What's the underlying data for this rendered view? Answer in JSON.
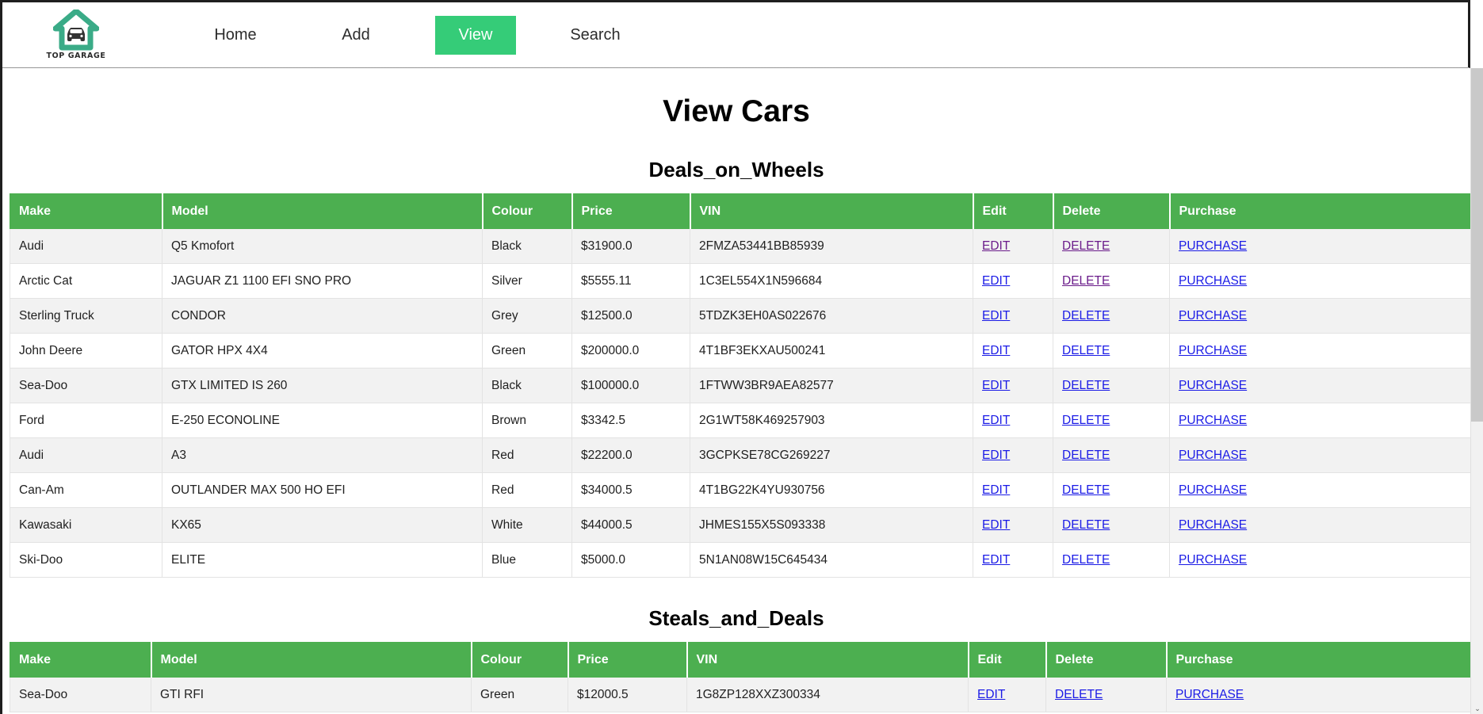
{
  "nav": {
    "logo": {
      "name": "top-garage-logo",
      "wordmark": "TOP GARAGE",
      "color": "#3aab87"
    },
    "items": [
      {
        "label": "Home",
        "active": false
      },
      {
        "label": "Add",
        "active": false
      },
      {
        "label": "View",
        "active": true
      },
      {
        "label": "Search",
        "active": false
      }
    ],
    "active_color": "#35cc78"
  },
  "page": {
    "title": "View Cars",
    "header_color": "#4caf50",
    "link_color": "#1a1ae6",
    "visited_link_color": "#6a1b8a"
  },
  "columns": [
    "Make",
    "Model",
    "Colour",
    "Price",
    "VIN",
    "Edit",
    "Delete",
    "Purchase"
  ],
  "actions": {
    "edit": "EDIT",
    "delete": "DELETE",
    "purchase": "PURCHASE"
  },
  "tables": [
    {
      "title": "Deals_on_Wheels",
      "rows": [
        {
          "make": "Audi",
          "model": "Q5 Kmofort",
          "colour": "Black",
          "price": "$31900.0",
          "vin": "2FMZA53441BB85939",
          "edit_visited": true,
          "delete_visited": true
        },
        {
          "make": "Arctic Cat",
          "model": "JAGUAR Z1 1100 EFI SNO PRO",
          "colour": "Silver",
          "price": "$5555.11",
          "vin": "1C3EL554X1N596684",
          "edit_visited": false,
          "delete_visited": true
        },
        {
          "make": "Sterling Truck",
          "model": "CONDOR",
          "colour": "Grey",
          "price": "$12500.0",
          "vin": "5TDZK3EH0AS022676",
          "edit_visited": false,
          "delete_visited": false
        },
        {
          "make": "John Deere",
          "model": "GATOR HPX 4X4",
          "colour": "Green",
          "price": "$200000.0",
          "vin": "4T1BF3EKXAU500241",
          "edit_visited": false,
          "delete_visited": false
        },
        {
          "make": "Sea-Doo",
          "model": "GTX LIMITED IS 260",
          "colour": "Black",
          "price": "$100000.0",
          "vin": "1FTWW3BR9AEA82577",
          "edit_visited": false,
          "delete_visited": false
        },
        {
          "make": "Ford",
          "model": "E-250 ECONOLINE",
          "colour": "Brown",
          "price": "$3342.5",
          "vin": "2G1WT58K469257903",
          "edit_visited": false,
          "delete_visited": false
        },
        {
          "make": "Audi",
          "model": "A3",
          "colour": "Red",
          "price": "$22200.0",
          "vin": "3GCPKSE78CG269227",
          "edit_visited": false,
          "delete_visited": false
        },
        {
          "make": "Can-Am",
          "model": "OUTLANDER MAX 500 HO EFI",
          "colour": "Red",
          "price": "$34000.5",
          "vin": "4T1BG22K4YU930756",
          "edit_visited": false,
          "delete_visited": false
        },
        {
          "make": "Kawasaki",
          "model": "KX65",
          "colour": "White",
          "price": "$44000.5",
          "vin": "JHMES155X5S093338",
          "edit_visited": false,
          "delete_visited": false
        },
        {
          "make": "Ski-Doo",
          "model": "ELITE",
          "colour": "Blue",
          "price": "$5000.0",
          "vin": "5N1AN08W15C645434",
          "edit_visited": false,
          "delete_visited": false
        }
      ]
    },
    {
      "title": "Steals_and_Deals",
      "rows": [
        {
          "make": "Sea-Doo",
          "model": "GTI RFI",
          "colour": "Green",
          "price": "$12000.5",
          "vin": "1G8ZP128XXZ300334",
          "edit_visited": false,
          "delete_visited": false
        }
      ]
    }
  ],
  "scrollbar": {
    "name": "vertical-scrollbar",
    "arrow_down": "⌄"
  }
}
